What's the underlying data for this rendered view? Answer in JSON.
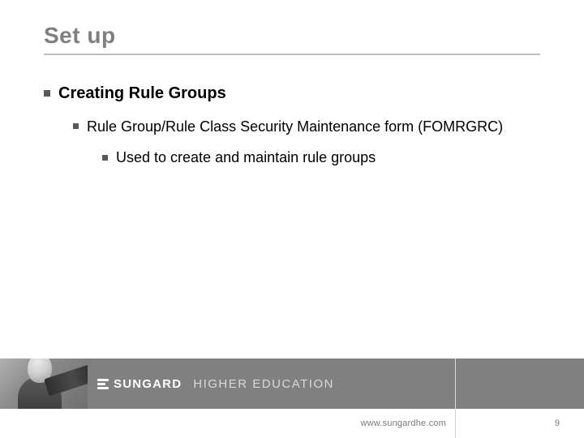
{
  "title": "Set up",
  "bullets": {
    "l1": "Creating Rule Groups",
    "l2": "Rule Group/Rule Class Security Maintenance form (FOMRGRC)",
    "l3": "Used to create and maintain rule groups"
  },
  "brand": {
    "sungard": "SUNGARD",
    "he": "HIGHER EDUCATION"
  },
  "footer": {
    "url": "www.sungardhe.com",
    "page": "9"
  }
}
